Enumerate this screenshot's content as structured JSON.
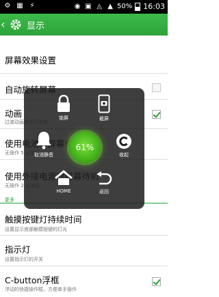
{
  "status_bar": {
    "battery": "50%",
    "time": "16:03"
  },
  "action_bar": {
    "title": "显示"
  },
  "settings": [
    {
      "title": "屏幕效果设置",
      "subtitle": ""
    },
    {
      "title": "自动旋转屏幕",
      "subtitle": "",
      "checked": false
    },
    {
      "title": "动画",
      "subtitle": "过渡动画模式已开启",
      "checked": true
    },
    {
      "title": "使用电池时屏幕待机",
      "subtitle": "无操作 5 分钟后",
      "checked": false
    },
    {
      "title": "使用外接电源时屏幕待机",
      "subtitle": "无操作 2 分钟后",
      "checked": false
    },
    {
      "title": "触摸按键灯持续时间",
      "subtitle": "设置显示底部触摸按键的灯光"
    },
    {
      "title": "指示灯",
      "subtitle": "设置指示灯的开关"
    },
    {
      "title": "C-button浮框",
      "subtitle": "浮动的快捷操作框，方便单手操作",
      "checked": true
    }
  ],
  "more_label": "更多",
  "floating_panel": {
    "lock": "锁屏",
    "screenshot": "截屏",
    "mute": "取消静音",
    "percent": "61%",
    "collapse": "收起",
    "home": "HOME",
    "back": "返回"
  },
  "colors": {
    "accent": "#2da33a",
    "overlay": "#1e1e1e"
  }
}
